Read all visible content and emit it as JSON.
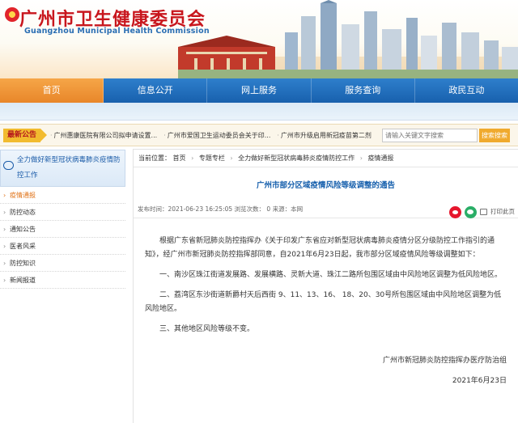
{
  "header": {
    "title": "广州市卫生健康委员会",
    "subtitle": "Guangzhou Municipal Health Commission"
  },
  "nav": [
    {
      "label": "首页"
    },
    {
      "label": "信息公开"
    },
    {
      "label": "网上服务"
    },
    {
      "label": "服务查询"
    },
    {
      "label": "政民互动"
    }
  ],
  "notice": {
    "label": "最新公告",
    "items": [
      "广州惠康医院有限公司拟申请设置...",
      "广州市爱国卫生运动委员会关于印...",
      "广州市升级启用新冠疫苗第二剂"
    ],
    "search_placeholder": "请输入关键文字搜索",
    "search_button": "搜索搜索"
  },
  "sidebar": {
    "heading": "全力做好新型冠状病毒肺炎疫情防控工作",
    "items": [
      {
        "label": "疫情通报"
      },
      {
        "label": "防控动态"
      },
      {
        "label": "通知公告"
      },
      {
        "label": "医者风采"
      },
      {
        "label": "防控知识"
      },
      {
        "label": "新闻报道"
      }
    ]
  },
  "breadcrumb": {
    "prefix": "当前位置：",
    "items": [
      "首页",
      "专题专栏",
      "全力做好新型冠状病毒肺炎疫情防控工作",
      "疫情通报"
    ]
  },
  "article": {
    "title": "广州市部分区域疫情风险等级调整的通告",
    "meta": "发布时间：2021-06-23 16:25:05   浏览次数：  0   来源：本网",
    "print_label": "打印此页",
    "paragraphs": [
      "根据广东省新冠肺炎防控指挥办《关于印发广东省应对新型冠状病毒肺炎疫情分区分级防控工作指引的通知》，经广州市新冠肺炎防控指挥部同意，自2021年6月23日起，我市部分区域疫情风险等级调整如下：",
      "一、南沙区珠江街道发展路、发展横路、灵新大道、珠江二路所包围区域由中风险地区调整为低风险地区。",
      "二、荔湾区东沙街道新爵村天后西街 9、11、13、16、 18、20、30号所包围区域由中风险地区调整为低风险地区。",
      "三、其他地区风险等级不变。"
    ],
    "signature": "广州市新冠肺炎防控指挥办医疗防治组",
    "date": "2021年6月23日"
  }
}
